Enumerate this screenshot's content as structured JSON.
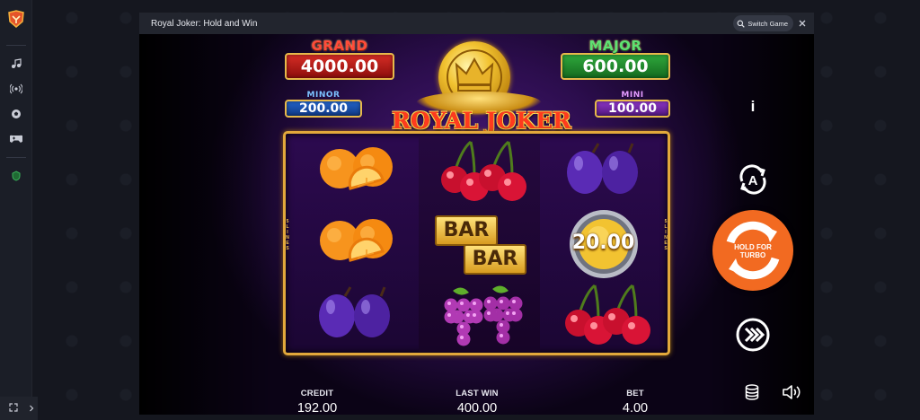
{
  "window": {
    "title": "Royal Joker: Hold and Win",
    "switch_label": "Switch Game"
  },
  "jackpots": {
    "grand": {
      "label": "GRAND",
      "value": "4000.00"
    },
    "major": {
      "label": "MAJOR",
      "value": "600.00"
    },
    "minor": {
      "label": "MINOR",
      "value": "200.00"
    },
    "mini": {
      "label": "MINI",
      "value": "100.00"
    }
  },
  "game_logo": "ROYAL JOKER",
  "reels": {
    "lines_label_left": [
      "5",
      "L",
      "I",
      "N",
      "E",
      "S"
    ],
    "lines_label_right": [
      "5",
      "L",
      "I",
      "N",
      "E",
      "S"
    ],
    "grid": [
      [
        "oranges",
        "cherries",
        "plums"
      ],
      [
        "oranges",
        "bar",
        "coin"
      ],
      [
        "plums",
        "grapes",
        "cherries"
      ]
    ],
    "bar_text": "BAR",
    "coin_value": "20.00"
  },
  "controls": {
    "info_label": "i",
    "spin_label_line1": "HOLD FOR",
    "spin_label_line2": "TURBO"
  },
  "stats": {
    "credit": {
      "label": "CREDIT",
      "value": "192.00"
    },
    "last_win": {
      "label": "LAST WIN",
      "value": "400.00"
    },
    "bet": {
      "label": "BET",
      "value": "4.00"
    }
  },
  "colors": {
    "spin_button": "#f26a21",
    "reel_frame": "#e2a83b",
    "grand": "#d62d26",
    "major": "#2fa83c",
    "minor": "#2463c9",
    "mini": "#8d35c6"
  }
}
